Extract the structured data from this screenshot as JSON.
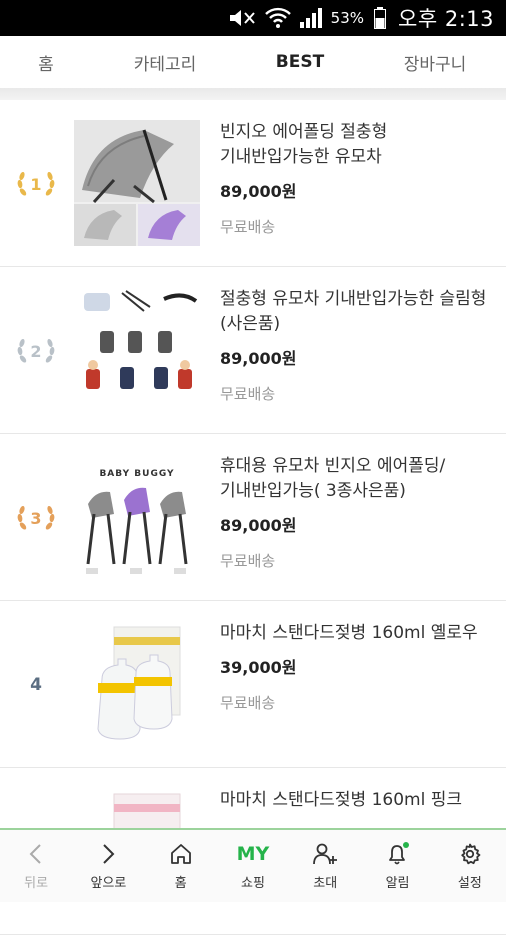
{
  "status_bar": {
    "battery": "53%",
    "time": "오후 2:13"
  },
  "tabs": [
    {
      "label": "홈"
    },
    {
      "label": "카테고리"
    },
    {
      "label": "BEST"
    },
    {
      "label": "장바구니"
    }
  ],
  "products": [
    {
      "rank": "1",
      "title": "빈지오 에어폴딩 절충형 기내반입가능한 유모차",
      "price": "89,000원",
      "shipping": "무료배송"
    },
    {
      "rank": "2",
      "title": "절충형 유모차 기내반입가능한 슬림형(사은품)",
      "price": "89,000원",
      "shipping": "무료배송"
    },
    {
      "rank": "3",
      "title": "휴대용 유모차 빈지오 에어폴딩/기내반입가능( 3종사은품)",
      "price": "89,000원",
      "shipping": "무료배송",
      "image_text": "BABY BUGGY"
    },
    {
      "rank": "4",
      "title": "마마치 스탠다드젖병 160ml 옐로우",
      "price": "39,000원",
      "shipping": "무료배송"
    },
    {
      "rank": "",
      "title": "마마치 스탠다드젖병 160ml 핑크",
      "price": "",
      "shipping": ""
    }
  ],
  "bottom_nav": [
    {
      "label": "뒤로",
      "icon": "chevron-left-icon"
    },
    {
      "label": "앞으로",
      "icon": "chevron-right-icon"
    },
    {
      "label": "홈",
      "icon": "home-icon"
    },
    {
      "label": "쇼핑",
      "icon": "my-text",
      "icon_text": "MY"
    },
    {
      "label": "초대",
      "icon": "add-user-icon"
    },
    {
      "label": "알림",
      "icon": "bell-icon"
    },
    {
      "label": "설정",
      "icon": "gear-icon"
    }
  ],
  "colors": {
    "gold": "#e9b84a",
    "silver": "#b9c1c8",
    "bronze": "#e4a05a",
    "green": "#25b34a"
  }
}
